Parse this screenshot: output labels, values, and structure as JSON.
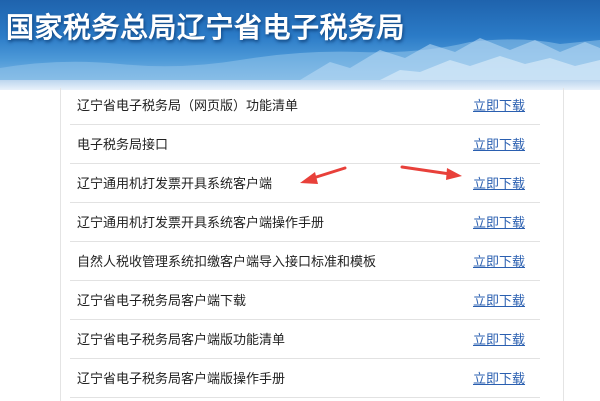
{
  "header": {
    "title": "国家税务总局辽宁省电子税务局"
  },
  "downloads": [
    {
      "title": "辽宁省电子税务局（网页版）功能清单",
      "link": "立即下载"
    },
    {
      "title": "电子税务局接口",
      "link": "立即下载"
    },
    {
      "title": "辽宁通用机打发票开具系统客户端",
      "link": "立即下载"
    },
    {
      "title": "辽宁通用机打发票开具系统客户端操作手册",
      "link": "立即下载"
    },
    {
      "title": "自然人税收管理系统扣缴客户端导入接口标准和模板",
      "link": "立即下载"
    },
    {
      "title": "辽宁省电子税务局客户端下载",
      "link": "立即下载"
    },
    {
      "title": "辽宁省电子税务局客户端版功能清单",
      "link": "立即下载"
    },
    {
      "title": "辽宁省电子税务局客户端版操作手册",
      "link": "立即下载"
    }
  ],
  "annotation": {
    "arrow_color": "#e8403a"
  }
}
